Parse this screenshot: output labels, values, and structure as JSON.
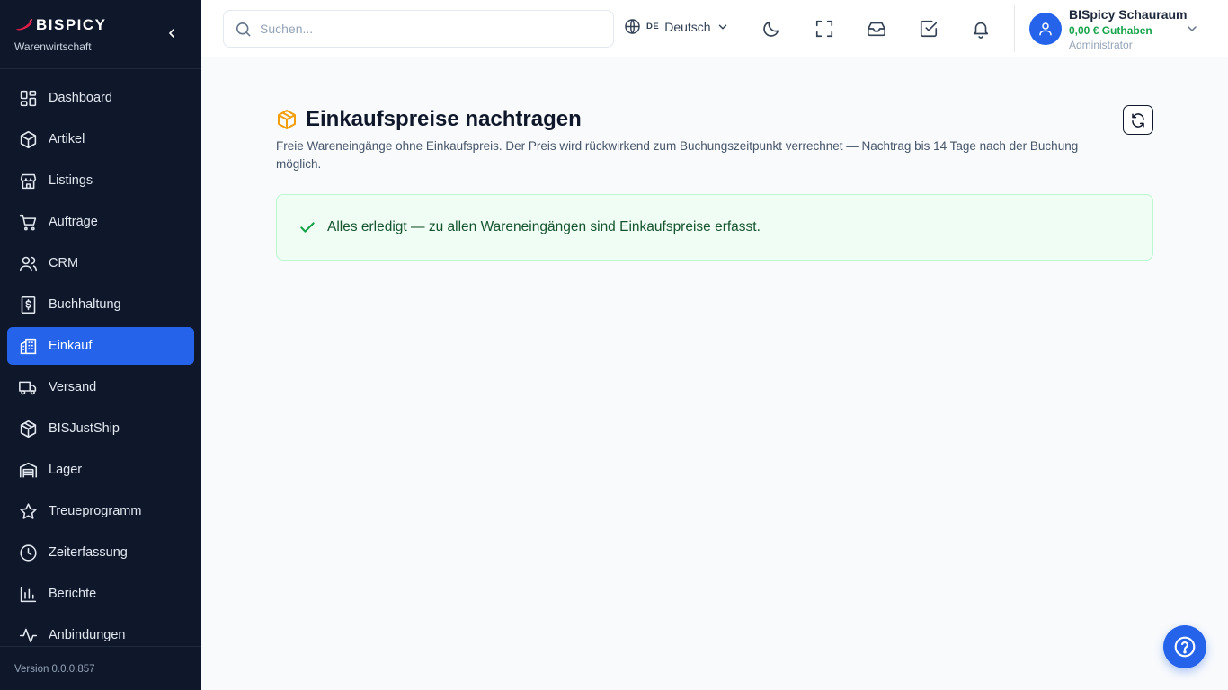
{
  "brand": {
    "name": "BISPICY",
    "subtitle": "Warenwirtschaft"
  },
  "sidebar": {
    "items": [
      {
        "label": "Dashboard",
        "icon": "dashboard-icon"
      },
      {
        "label": "Artikel",
        "icon": "box-icon"
      },
      {
        "label": "Listings",
        "icon": "store-icon"
      },
      {
        "label": "Aufträge",
        "icon": "cart-icon"
      },
      {
        "label": "CRM",
        "icon": "users-icon"
      },
      {
        "label": "Buchhaltung",
        "icon": "dollar-receipt-icon"
      },
      {
        "label": "Einkauf",
        "icon": "building-icon",
        "active": true
      },
      {
        "label": "Versand",
        "icon": "truck-icon"
      },
      {
        "label": "BISJustShip",
        "icon": "package-icon"
      },
      {
        "label": "Lager",
        "icon": "warehouse-icon"
      },
      {
        "label": "Treueprogramm",
        "icon": "star-icon"
      },
      {
        "label": "Zeiterfassung",
        "icon": "clock-icon"
      },
      {
        "label": "Berichte",
        "icon": "bar-chart-icon"
      },
      {
        "label": "Anbindungen",
        "icon": "activity-icon"
      }
    ],
    "version": "Version 0.0.0.857"
  },
  "topbar": {
    "search_placeholder": "Suchen...",
    "language_code": "DE",
    "language_label": "Deutsch",
    "user": {
      "name": "BISpicy Schauraum",
      "credit": "0,00 € Guthaben",
      "role": "Administrator"
    }
  },
  "main": {
    "title": "Einkaufspreise nachtragen",
    "description": "Freie Wareneingänge ohne Einkaufspreis. Der Preis wird rückwirkend zum Buchungszeitpunkt verrechnet — Nachtrag bis 14 Tage nach der Buchung möglich.",
    "success_message": "Alles erledigt — zu allen Wareneingängen sind Einkaufspreise erfasst."
  },
  "colors": {
    "sidebar_bg": "#0f172a",
    "accent": "#2563eb",
    "success_bg": "#f0fdf4",
    "success_border": "#bbf7d0",
    "success_text": "#14532d",
    "credit": "#16a34a",
    "title_icon": "#f59e0b"
  }
}
